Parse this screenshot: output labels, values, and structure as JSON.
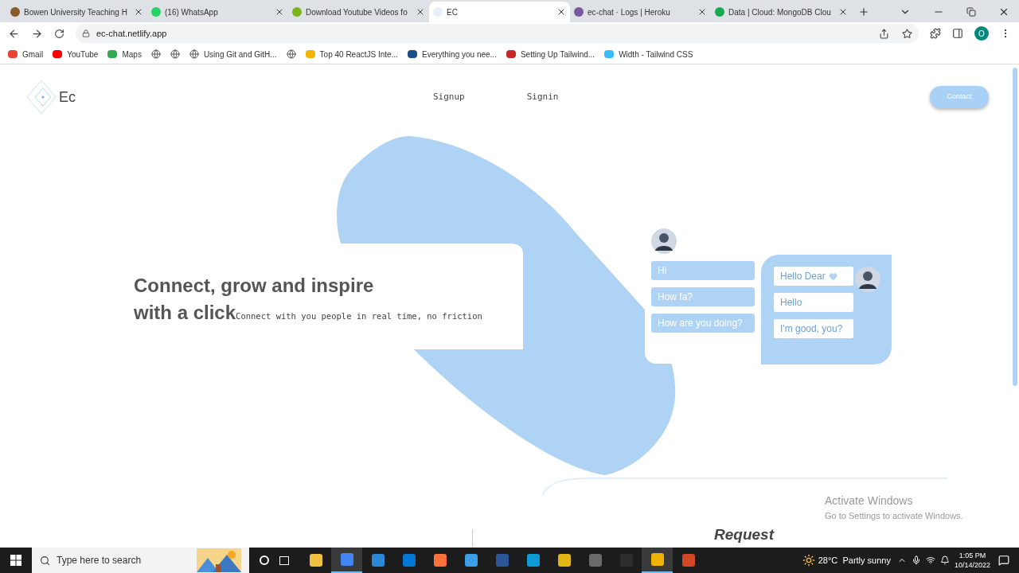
{
  "browser": {
    "tabs": [
      {
        "title": "Bowen University Teaching H",
        "selected": false,
        "color": "#8b5a2b"
      },
      {
        "title": "(16) WhatsApp",
        "selected": false,
        "color": "#25d366"
      },
      {
        "title": "Download Youtube Videos fo",
        "selected": false,
        "color": "#7cb518"
      },
      {
        "title": "EC",
        "selected": true,
        "color": "#e8eef5"
      },
      {
        "title": "ec-chat · Logs | Heroku",
        "selected": false,
        "color": "#79589f"
      },
      {
        "title": "Data | Cloud: MongoDB Clou",
        "selected": false,
        "color": "#13aa52"
      }
    ],
    "address": "ec-chat.netlify.app",
    "profile": "O",
    "bookmarks": [
      {
        "kind": "link",
        "label": "Gmail",
        "color": "#ea4335"
      },
      {
        "kind": "link",
        "label": "YouTube",
        "color": "#ff0000"
      },
      {
        "kind": "link",
        "label": "Maps",
        "color": "#34a853"
      },
      {
        "kind": "globe"
      },
      {
        "kind": "globe"
      },
      {
        "kind": "globe",
        "label": "Using Git and GitH..."
      },
      {
        "kind": "globe"
      },
      {
        "kind": "link",
        "label": "Top 40 ReactJS Inte...",
        "color": "#f4b400"
      },
      {
        "kind": "link",
        "label": "Everything you nee...",
        "color": "#1d4e89"
      },
      {
        "kind": "link",
        "label": "Setting Up Tailwind...",
        "color": "#c62828"
      },
      {
        "kind": "link",
        "label": "Width - Tailwind CSS",
        "color": "#38bdf8"
      }
    ]
  },
  "page": {
    "logo": "Ec",
    "nav": [
      "Signup",
      "Signin"
    ],
    "contact": "Contact",
    "headline": [
      "Connect, grow and inspire",
      "with a click"
    ],
    "subtitle": "Connect with you people in real time, no friction",
    "chat_left": [
      "Hi",
      "How fa?",
      "How are you doing?"
    ],
    "chat_right": [
      {
        "text": "Hello Dear",
        "heart": true
      },
      {
        "text": "Hello",
        "heart": false
      },
      {
        "text": "I'm good, you?",
        "heart": false
      }
    ],
    "request": "Request"
  },
  "watermark": {
    "title": "Activate Windows",
    "note": "Go to Settings to activate Windows."
  },
  "taskbar": {
    "search_placeholder": "Type here to search",
    "apps": [
      {
        "color": "#f0c040",
        "active": false
      },
      {
        "color": "#4285f4",
        "active": true
      },
      {
        "color": "#2b88d8",
        "active": false
      },
      {
        "color": "#0078d4",
        "active": false
      },
      {
        "color": "#ff7139",
        "active": false
      },
      {
        "color": "#3ca0e6",
        "active": false
      },
      {
        "color": "#2b579a",
        "active": false
      },
      {
        "color": "#0c9bd7",
        "active": false
      },
      {
        "color": "#e2b714",
        "active": false
      },
      {
        "color": "#6b6b6b",
        "active": false
      },
      {
        "color": "#2d2d2d",
        "active": false
      },
      {
        "color": "#f0b400",
        "active": true
      },
      {
        "color": "#d24726",
        "active": false
      }
    ],
    "weather": "28°C  Partly sunny",
    "time": "1:05 PM",
    "date": "10/14/2022"
  }
}
